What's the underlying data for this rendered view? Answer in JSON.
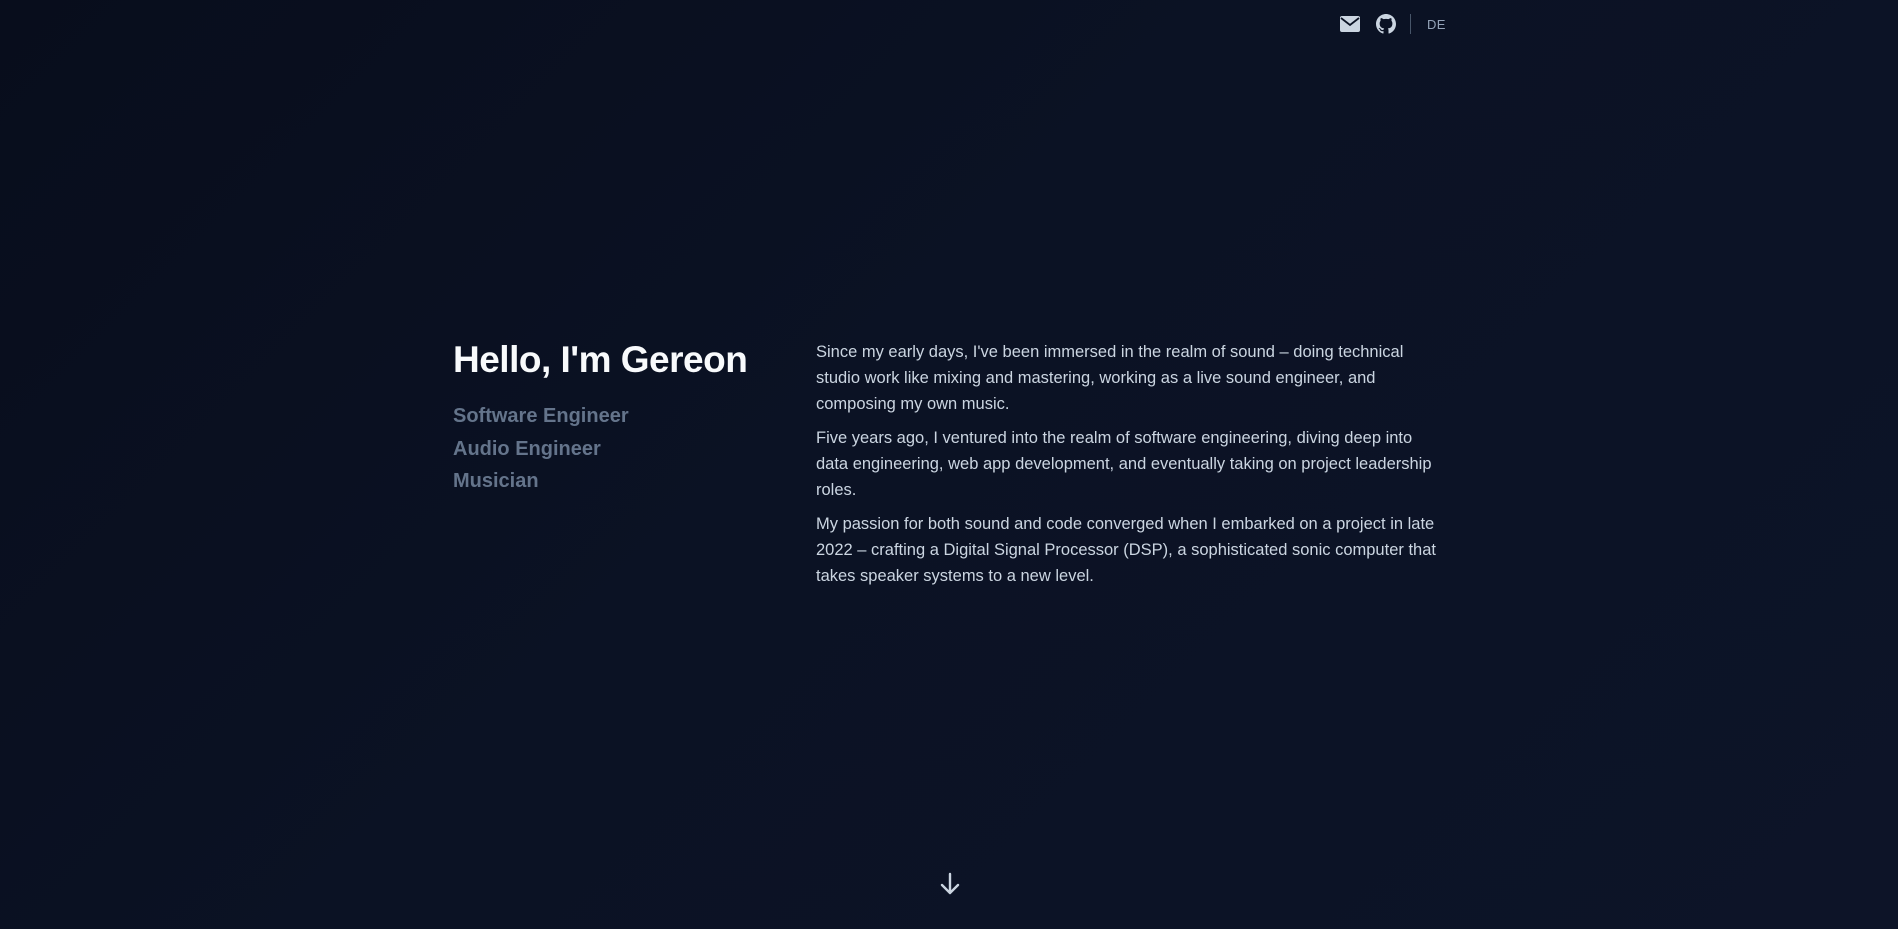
{
  "header": {
    "icons": {
      "mail": "envelope-icon",
      "github": "github-icon"
    },
    "language_label": "DE"
  },
  "hero": {
    "title": "Hello, I'm Gereon",
    "roles": [
      "Software Engineer",
      "Audio Engineer",
      "Musician"
    ],
    "paragraphs": [
      "Since my early days, I've been immersed in the realm of sound – doing technical studio work like mixing and mastering, working as a live sound engineer, and composing my own music.",
      "Five years ago, I ventured into the realm of software engineering, diving deep into data engineering, web app development, and eventually taking on project leadership roles.",
      "My passion for both sound and code converged when I embarked on a project in late 2022 – crafting a Digital Signal Processor (DSP), a sophisticated sonic computer that takes speaker systems to a new level."
    ]
  },
  "scroll": {
    "icon": "arrow-down-icon"
  },
  "colors": {
    "background": "#0b1224",
    "title": "#f8fafc",
    "roles": "#64748b",
    "body_text": "#cbd5e1",
    "icons": "#cbd5e1"
  }
}
